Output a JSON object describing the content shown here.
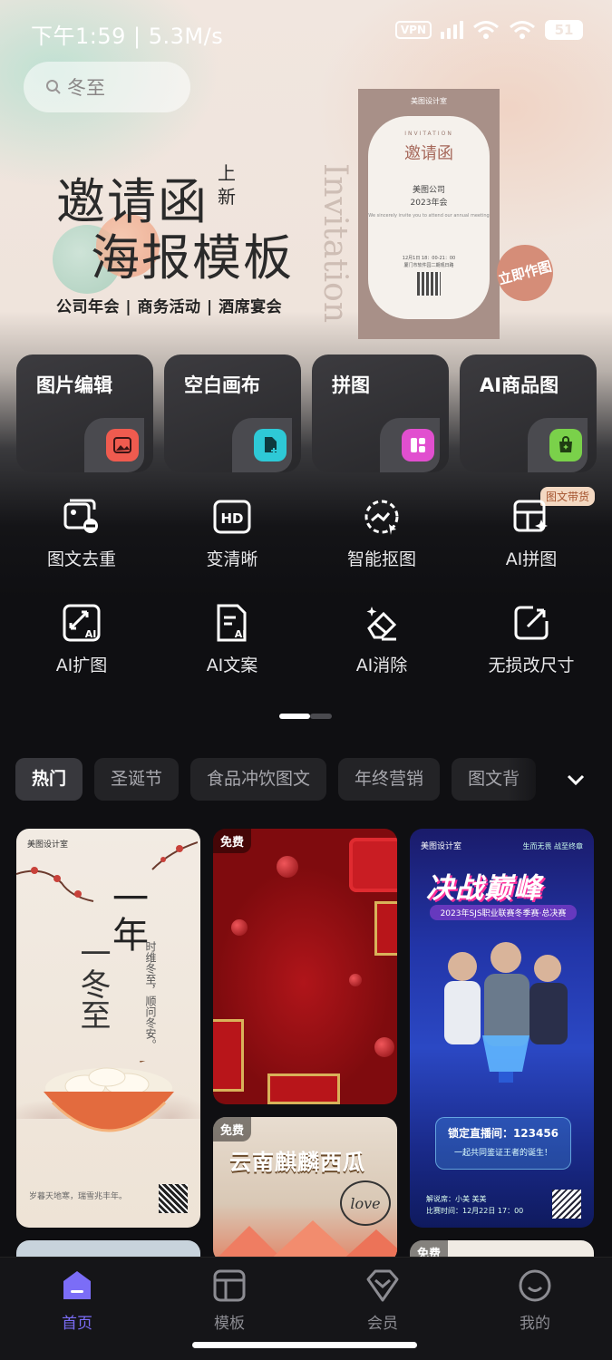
{
  "status_bar": {
    "time_speed": "下午1:59 | 5.3M/s",
    "vpn": "VPN",
    "battery": "51"
  },
  "search": {
    "placeholder": "冬至"
  },
  "banner": {
    "title_line1": "邀请函",
    "new_tag": "上新",
    "title_line2": "海报模板",
    "subtitle": "公司年会 | 商务活动 | 酒席宴会",
    "vertical_text": "Invitation",
    "card": {
      "logo": "美图设计室",
      "label": "INVITATION",
      "title": "邀请函",
      "company": "美图公司",
      "event": "2023年会",
      "small": "We sincerely invite you to attend our annual meeting",
      "date": "12月1日 18：00-21：00",
      "address": "厦门市软件园二期观日路"
    },
    "cta": "立即作图"
  },
  "features": [
    {
      "label": "图片编辑",
      "icon": "image-edit-icon",
      "color": "#ef5b4f"
    },
    {
      "label": "空白画布",
      "icon": "blank-canvas-icon",
      "color": "#2ec9d6"
    },
    {
      "label": "拼图",
      "icon": "collage-icon",
      "color": "#e14fcf"
    },
    {
      "label": "AI商品图",
      "icon": "ai-product-icon",
      "color": "#7ad14a"
    }
  ],
  "tools": [
    {
      "label": "图文去重",
      "icon": "dedupe-icon"
    },
    {
      "label": "变清晰",
      "icon": "hd-icon"
    },
    {
      "label": "智能抠图",
      "icon": "smart-cutout-icon"
    },
    {
      "label": "AI拼图",
      "icon": "ai-collage-icon",
      "tag": "图文带货"
    },
    {
      "label": "AI扩图",
      "icon": "ai-expand-icon"
    },
    {
      "label": "AI文案",
      "icon": "ai-copywriting-icon"
    },
    {
      "label": "AI消除",
      "icon": "ai-eraser-icon"
    },
    {
      "label": "无损改尺寸",
      "icon": "resize-icon"
    }
  ],
  "categories": [
    "热门",
    "圣诞节",
    "食品冲饮图文",
    "年终营销",
    "图文背"
  ],
  "templates": {
    "winter": {
      "logo": "美图设计室",
      "big1": "一年",
      "big2": "一冬至",
      "poem": "时维冬至，顺问冬安。",
      "foot": "岁暮天地寒，瑞雪兆丰年。"
    },
    "christmas": {
      "free": "免费"
    },
    "melon": {
      "free": "免费",
      "title": "云南麒麟西瓜",
      "love": "love"
    },
    "esports": {
      "logo": "美图设计室",
      "slogan": "生而无畏 战至终章",
      "title": "决战巅峰",
      "sub": "2023年SJS职业联赛冬季赛·总决赛",
      "live_a": "锁定直播间：123456",
      "live_b": "一起共同鉴证王者的诞生！",
      "info1": "解说席：小美 美美",
      "info2": "比赛时间：12月22日 17：00"
    },
    "bottom_free": "免费"
  },
  "nav": [
    {
      "label": "首页",
      "icon": "home-icon",
      "active": true
    },
    {
      "label": "模板",
      "icon": "template-icon"
    },
    {
      "label": "会员",
      "icon": "vip-icon"
    },
    {
      "label": "我的",
      "icon": "profile-icon"
    }
  ],
  "colors": {
    "accent": "#7b6df7",
    "background": "#0f0f12"
  }
}
